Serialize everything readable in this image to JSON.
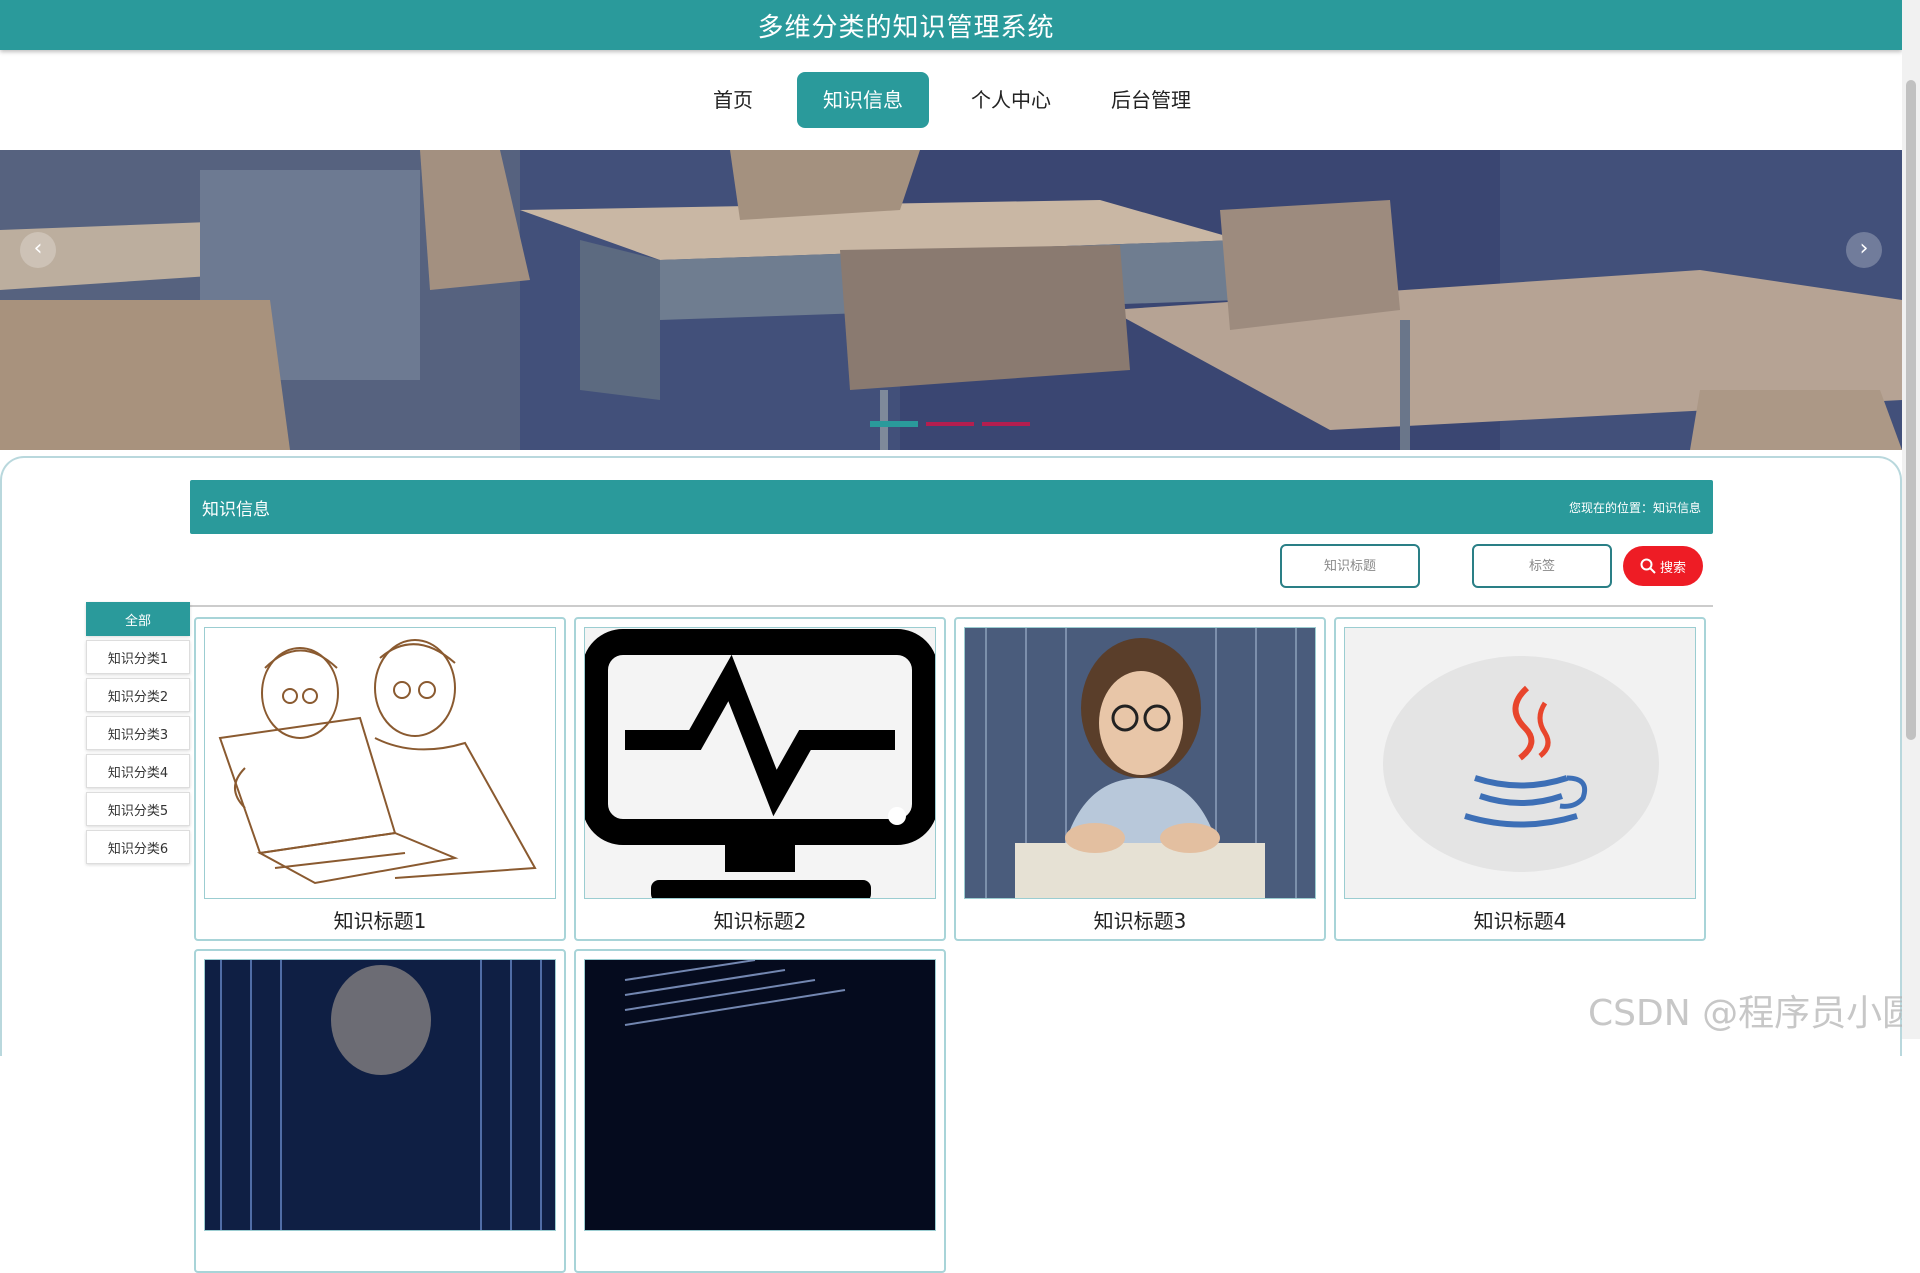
{
  "header": {
    "title": "多维分类的知识管理系统"
  },
  "nav": {
    "items": [
      {
        "label": "首页",
        "active": false
      },
      {
        "label": "知识信息",
        "active": true
      },
      {
        "label": "个人中心",
        "active": false
      },
      {
        "label": "后台管理",
        "active": false
      }
    ]
  },
  "banner": {
    "prev_glyph": "‹",
    "next_glyph": "›",
    "active_slide": 1,
    "slide_count": 3
  },
  "section": {
    "title": "知识信息",
    "location_prefix": "您现在的位置：",
    "location": "知识信息"
  },
  "search": {
    "title_placeholder": "知识标题",
    "tag_placeholder": "标签",
    "button_label": "搜索"
  },
  "categories": [
    "全部",
    "知识分类1",
    "知识分类2",
    "知识分类3",
    "知识分类4",
    "知识分类5",
    "知识分类6"
  ],
  "cards": [
    {
      "title": "知识标题1",
      "image": "sketch-people-laptop"
    },
    {
      "title": "知识标题2",
      "image": "monitor-pulse-icon"
    },
    {
      "title": "知识标题3",
      "image": "boy-keyboard-photo"
    },
    {
      "title": "知识标题4",
      "image": "java-logo"
    },
    {
      "title": "",
      "image": "hooded-hacker-photo"
    },
    {
      "title": "",
      "image": "code-screen-photo"
    }
  ],
  "watermark": "CSDN @程序员小圆",
  "colors": {
    "primary": "#2a9a9b",
    "search_button": "#ee1c25"
  }
}
